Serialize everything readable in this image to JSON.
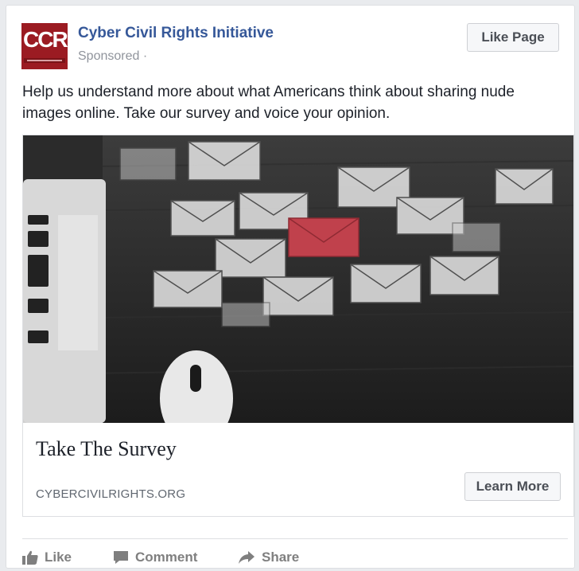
{
  "post": {
    "page_name": "Cyber Civil Rights Initiative",
    "logo_text": "CCRI",
    "meta": "Sponsored ·",
    "like_page_label": "Like Page",
    "text": "Help us understand more about what Americans think about sharing nude images online. Take our survey and voice your opinion."
  },
  "link": {
    "title": "Take The Survey",
    "domain": "CYBERCIVILRIGHTS.ORG",
    "cta_label": "Learn More"
  },
  "actions": {
    "like_label": "Like",
    "comment_label": "Comment",
    "share_label": "Share"
  },
  "colors": {
    "brand_blue": "#365899",
    "logo_red": "#9b1b22",
    "highlight_envelope": "#c0414c"
  },
  "icons": [
    "thumbs-up-icon",
    "comment-icon",
    "share-icon"
  ]
}
